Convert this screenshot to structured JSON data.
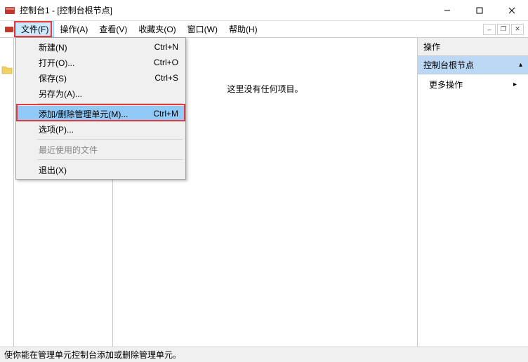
{
  "window": {
    "title": "控制台1 - [控制台根节点]"
  },
  "menubar": {
    "items": [
      {
        "label": "文件(F)"
      },
      {
        "label": "操作(A)"
      },
      {
        "label": "查看(V)"
      },
      {
        "label": "收藏夹(O)"
      },
      {
        "label": "窗口(W)"
      },
      {
        "label": "帮助(H)"
      }
    ]
  },
  "file_menu": {
    "new": {
      "label": "新建(N)",
      "shortcut": "Ctrl+N"
    },
    "open": {
      "label": "打开(O)...",
      "shortcut": "Ctrl+O"
    },
    "save": {
      "label": "保存(S)",
      "shortcut": "Ctrl+S"
    },
    "saveas": {
      "label": "另存为(A)..."
    },
    "snapin": {
      "label": "添加/删除管理单元(M)...",
      "shortcut": "Ctrl+M"
    },
    "options": {
      "label": "选项(P)..."
    },
    "recent": {
      "label": "最近使用的文件"
    },
    "exit": {
      "label": "退出(X)"
    }
  },
  "content": {
    "empty_text": "这里没有任何项目。"
  },
  "actions_panel": {
    "header": "操作",
    "section": "控制台根节点",
    "more": "更多操作"
  },
  "statusbar": {
    "text": "使你能在管理单元控制台添加或删除管理单元。"
  }
}
